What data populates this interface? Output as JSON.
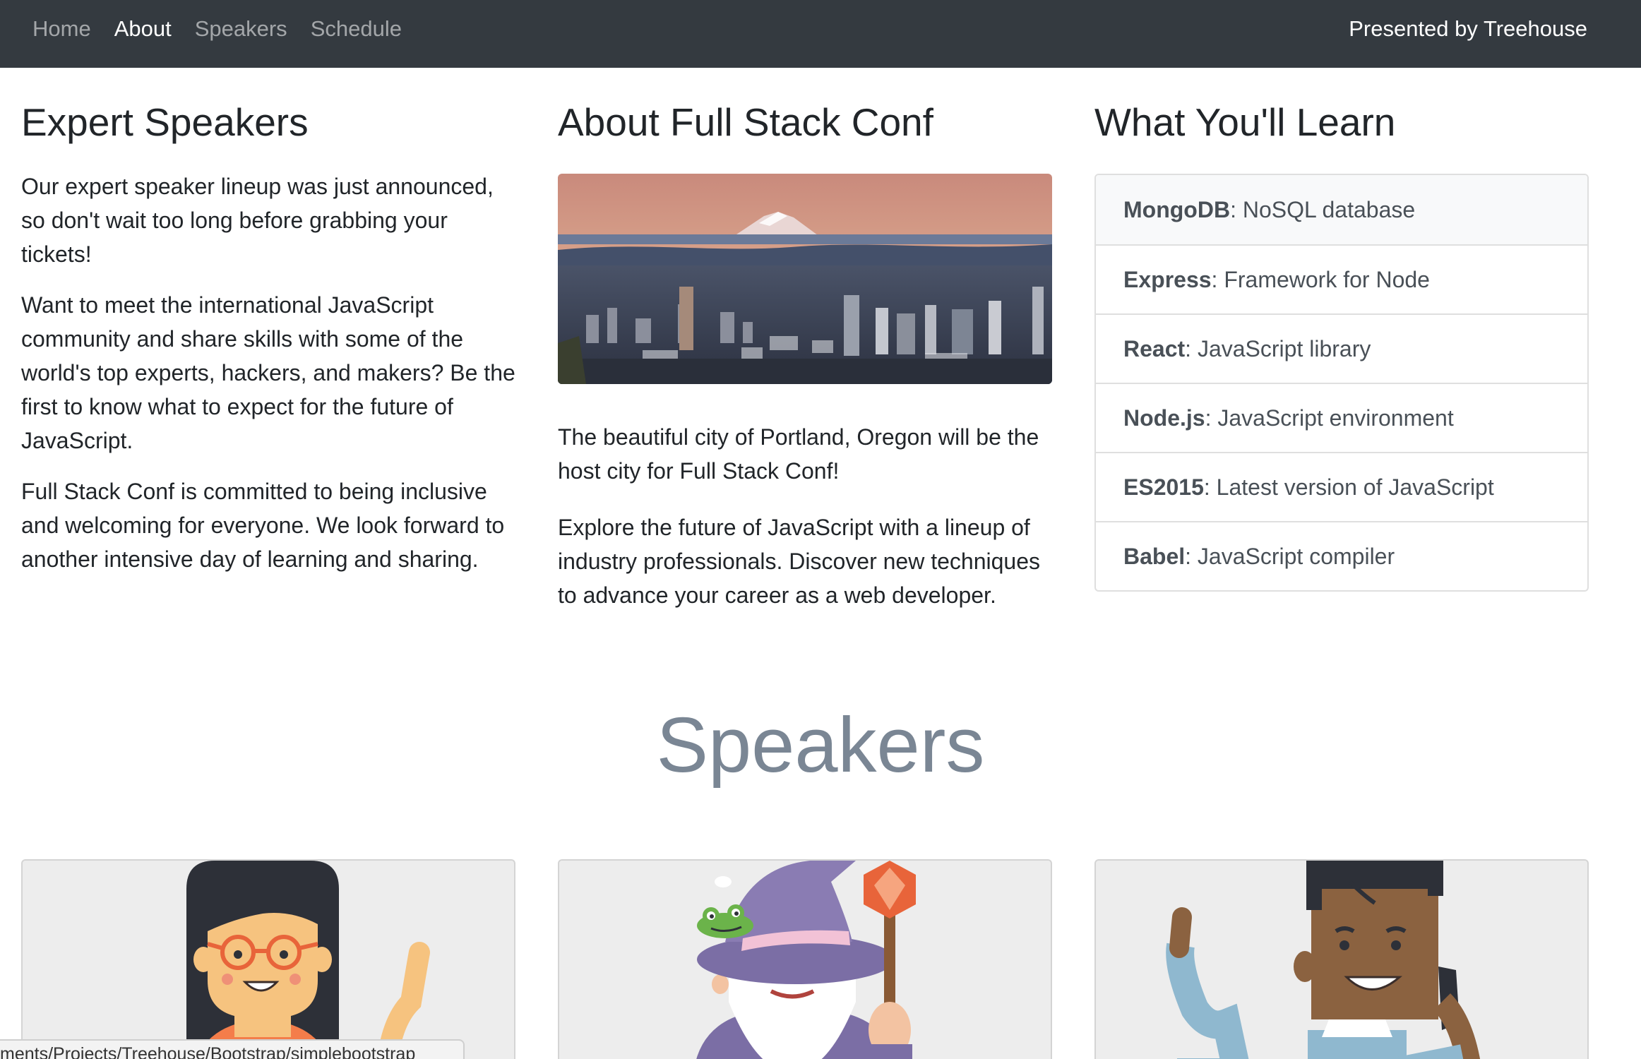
{
  "nav": {
    "links": [
      "Home",
      "About",
      "Speakers",
      "Schedule"
    ],
    "active": "About",
    "right_text": "Presented by Treehouse"
  },
  "col1": {
    "title": "Expert Speakers",
    "paragraphs": [
      "Our expert speaker lineup was just announced, so don't wait too long before grabbing your tickets!",
      "Want to meet the international JavaScript community and share skills with some of the world's top experts, hackers, and makers? Be the first to know what to expect for the future of JavaScript.",
      "Full Stack Conf is committed to being inclusive and welcoming for everyone. We look forward to another intensive day of learning and sharing."
    ]
  },
  "col2": {
    "title": "About Full Stack Conf",
    "paragraphs": [
      "The beautiful city of Portland, Oregon will be the host city for Full Stack Conf!",
      "Explore the future of JavaScript with a lineup of industry professionals. Discover new techniques to advance your career as a web developer."
    ]
  },
  "col3": {
    "title": "What You'll Learn",
    "items": [
      {
        "name": "MongoDB",
        "desc": ": NoSQL database"
      },
      {
        "name": "Express",
        "desc": ": Framework for Node"
      },
      {
        "name": "React",
        "desc": ": JavaScript library"
      },
      {
        "name": "Node.js",
        "desc": ": JavaScript environment"
      },
      {
        "name": "ES2015",
        "desc": ": Latest version of JavaScript"
      },
      {
        "name": "Babel",
        "desc": ": JavaScript compiler"
      }
    ]
  },
  "speakers": {
    "heading": "Speakers",
    "cards": [
      "woman-avatar",
      "wizard-avatar",
      "man-avatar"
    ]
  },
  "status_bar": {
    "text": "ments/Projects/Treehouse/Bootstrap/simplebootstrap"
  },
  "colors": {
    "navbar_bg": "#343a40",
    "text": "#212529",
    "muted_heading": "#7a8694",
    "list_active_bg": "#f8f9fa"
  }
}
